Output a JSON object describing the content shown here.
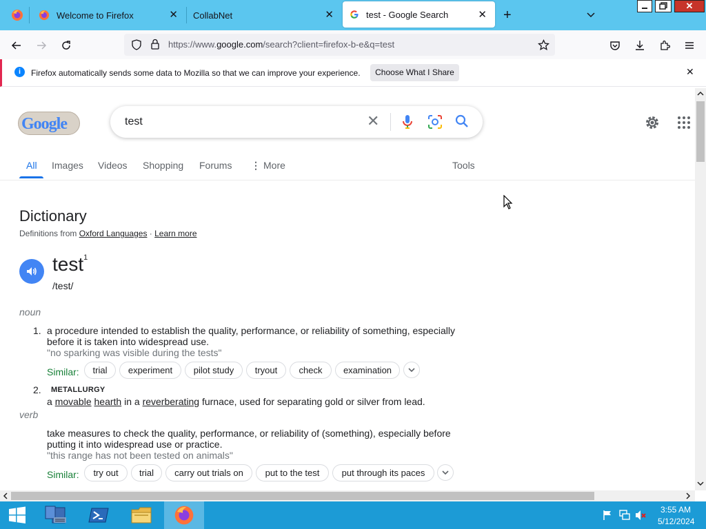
{
  "browser": {
    "tabs": [
      {
        "label": "Welcome to Firefox"
      },
      {
        "label": "CollabNet"
      },
      {
        "label": "test - Google Search",
        "active": true
      }
    ],
    "url": {
      "prefix": "https://www.",
      "host": "google.com",
      "path": "/search?client=firefox-b-e&q=test"
    },
    "notification": {
      "text": "Firefox automatically sends some data to Mozilla so that we can improve your experience.",
      "button": "Choose What I Share"
    }
  },
  "search": {
    "logo_text": "Google",
    "query": "test",
    "tabs": [
      "All",
      "Images",
      "Videos",
      "Shopping",
      "Forums",
      "More"
    ],
    "tools": "Tools"
  },
  "dictionary": {
    "title": "Dictionary",
    "source_prefix": "Definitions from ",
    "source_link": "Oxford Languages",
    "source_sep": " · ",
    "learn_more": "Learn more",
    "word": "test",
    "superscript": "1",
    "phonetic": "/test/",
    "noun": {
      "pos": "noun",
      "senses": [
        {
          "num": "1.",
          "def": "a procedure intended to establish the quality, performance, or reliability of something, especially before it is taken into widespread use.",
          "example": "\"no sparking was visible during the tests\"",
          "similar_label": "Similar:",
          "similar": [
            "trial",
            "experiment",
            "pilot study",
            "tryout",
            "check",
            "examination"
          ]
        },
        {
          "num": "2.",
          "label": "METALLURGY",
          "def_pre": "a ",
          "def_w1": "movable",
          "def_s1": " ",
          "def_w2": "hearth",
          "def_s2": " in a ",
          "def_w3": "reverberating",
          "def_post": " furnace, used for separating gold or silver from lead."
        }
      ]
    },
    "verb": {
      "pos": "verb",
      "def": "take measures to check the quality, performance, or reliability of (something), especially before putting it into widespread use or practice.",
      "example": "\"this range has not been tested on animals\"",
      "similar_label": "Similar:",
      "similar": [
        "try out",
        "trial",
        "carry out trials on",
        "put to the test",
        "put through its paces"
      ]
    }
  },
  "taskbar": {
    "time": "3:55 AM",
    "date": "5/12/2024"
  },
  "colors": {
    "tabbar": "#5bc6ef",
    "google_blue": "#1a73e8",
    "similar_green": "#188038",
    "taskbar": "#1c9bd6"
  }
}
